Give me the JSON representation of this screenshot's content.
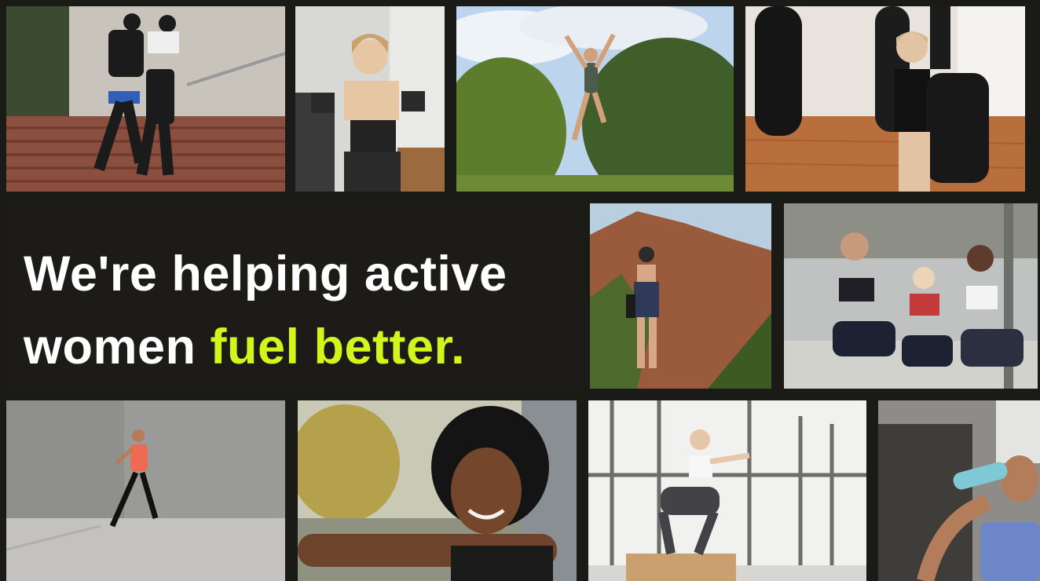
{
  "headline": {
    "line1": "We're helping active",
    "line2_prefix": "women ",
    "line2_accent": "fuel better."
  },
  "colors": {
    "background": "#1a1a16",
    "text": "#ffffff",
    "accent": "#d4f51c"
  },
  "photos": [
    {
      "name": "photo-stair-runners"
    },
    {
      "name": "photo-dumbbell-curl"
    },
    {
      "name": "photo-jumping-woman"
    },
    {
      "name": "photo-boxing-gym"
    },
    {
      "name": "photo-rock-hiker"
    },
    {
      "name": "photo-studio-friends"
    },
    {
      "name": "photo-street-runner"
    },
    {
      "name": "photo-smiling-stretch"
    },
    {
      "name": "photo-box-squat"
    },
    {
      "name": "photo-drinking-water"
    }
  ]
}
